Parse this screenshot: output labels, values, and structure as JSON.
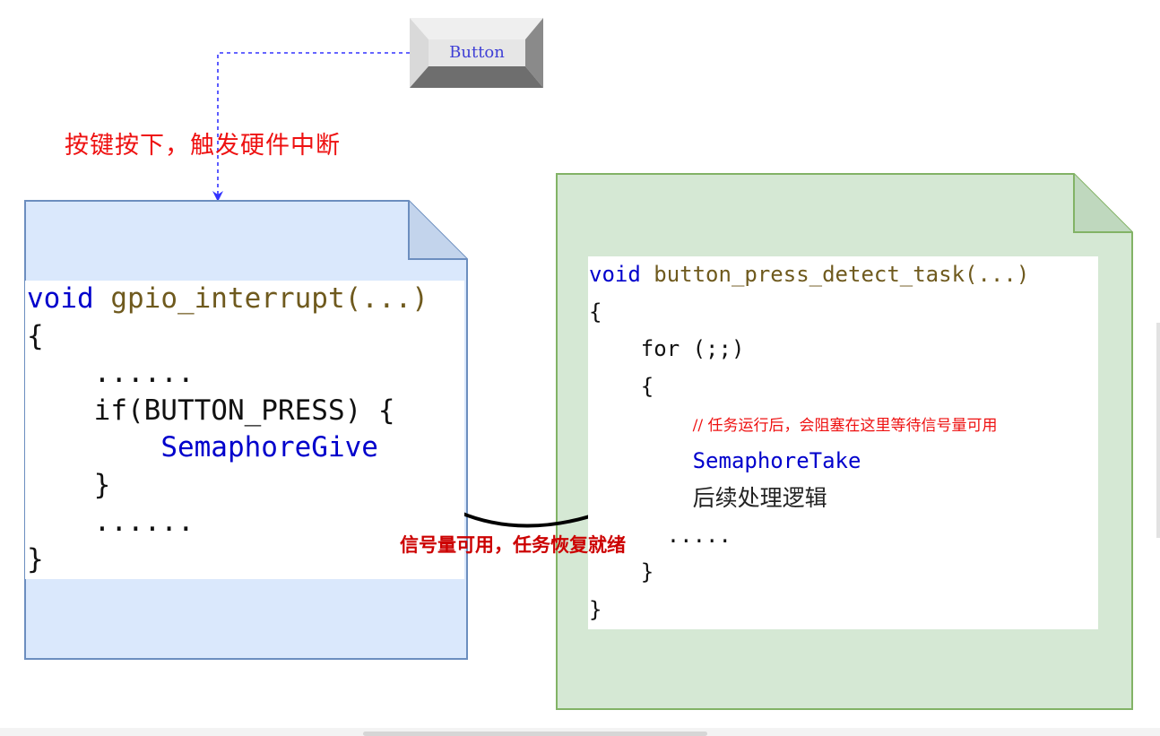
{
  "button": {
    "label": "Button"
  },
  "trigger_label": "按键按下，触发硬件中断",
  "isr_code": {
    "kw_void": "void",
    "fn_name": "gpio_interrupt(...)",
    "open_brace": "{",
    "ellipsis_top": "    ......",
    "if_line": "    if(BUTTON_PRESS) {",
    "give_call": "SemaphoreGive",
    "close_if": "    }",
    "ellipsis_bottom": "    ......",
    "close_brace": "}"
  },
  "task_code": {
    "kw_void": "void",
    "fn_name": "button_press_detect_task(...)",
    "open_brace": "{",
    "for_line": "    for (;;)",
    "for_open": "    {",
    "comment": "// 任务运行后，会阻塞在这里等待信号量可用",
    "take_call": "SemaphoreTake",
    "follow_up": "后续处理逻辑",
    "ellipsis": "      .....",
    "for_close": "    }",
    "close_brace": "}"
  },
  "ready_label": "信号量可用，任务恢复就绪",
  "colors": {
    "left_note_fill": "#dae8fc",
    "left_note_stroke": "#6c8ebf",
    "right_note_fill": "#d5e8d4",
    "right_note_stroke": "#82b366",
    "dashed_connector": "#3333ff",
    "red_text": "#ee1111",
    "dark_red_text": "#cc0000",
    "keyword": "#0000cc",
    "function_name": "#6f5a1e"
  }
}
